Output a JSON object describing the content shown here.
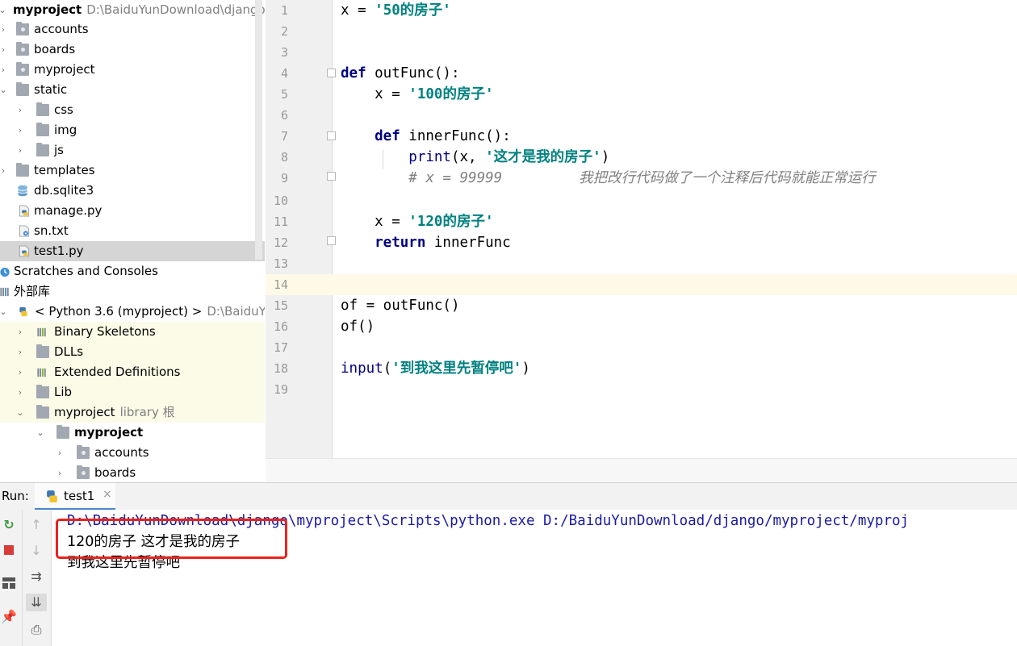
{
  "project_tree": {
    "items": [
      {
        "label": "myproject",
        "hint": "D:\\BaiduYunDownload\\django\\",
        "bold": true
      },
      {
        "label": "accounts"
      },
      {
        "label": "boards"
      },
      {
        "label": "myproject"
      },
      {
        "label": "static"
      },
      {
        "label": "css"
      },
      {
        "label": "img"
      },
      {
        "label": "js"
      },
      {
        "label": "templates"
      },
      {
        "label": "db.sqlite3"
      },
      {
        "label": "manage.py"
      },
      {
        "label": "sn.txt"
      },
      {
        "label": "test1.py",
        "selected": true
      },
      {
        "label": "Scratches and Consoles"
      },
      {
        "label": "外部库"
      },
      {
        "label": "< Python 3.6 (myproject) >",
        "hint": "D:\\BaiduYun"
      },
      {
        "label": "Binary Skeletons"
      },
      {
        "label": "DLLs"
      },
      {
        "label": "Extended Definitions"
      },
      {
        "label": "Lib"
      },
      {
        "label": "myproject",
        "hint": "library 根"
      },
      {
        "label": "myproject",
        "bold": true
      },
      {
        "label": "accounts"
      },
      {
        "label": "boards"
      }
    ]
  },
  "editor": {
    "line_numbers": [
      "1",
      "2",
      "3",
      "4",
      "5",
      "6",
      "7",
      "8",
      "9",
      "10",
      "11",
      "12",
      "13",
      "14",
      "15",
      "16",
      "17",
      "18",
      "19"
    ],
    "current_line": "14",
    "lines": {
      "l1": {
        "a": "x = ",
        "b": "'50的房子'"
      },
      "l4": {
        "kw": "def",
        "fn": " outFunc():"
      },
      "l5": {
        "a": "    x = ",
        "b": "'100的房子'"
      },
      "l7": {
        "kw": "    def",
        "fn": " innerFunc():"
      },
      "l8": {
        "bi": "        print",
        "a": "(x, ",
        "b": "'这才是我的房子'",
        "c": ")"
      },
      "l9": {
        "cm": "        # x = 99999         我把改行代码做了一个注释后代码就能正常运行"
      },
      "l11": {
        "a": "    x = ",
        "b": "'120的房子'"
      },
      "l12": {
        "kw": "    return",
        "a": " innerFunc"
      },
      "l15": {
        "a": "of = outFunc()"
      },
      "l16": {
        "a": "of()"
      },
      "l18": {
        "bi": "input",
        "a": "(",
        "b": "'到我这里先暂停吧'",
        "c": ")"
      }
    }
  },
  "run_panel": {
    "label": "Run:",
    "tab": "test1",
    "tab_close": "×",
    "console": {
      "command": "D:\\BaiduYunDownload\\django\\myproject\\Scripts\\python.exe D:/BaiduYunDownload/django/myproject/myproj",
      "output": [
        "120的房子 这才是我的房子",
        "到我这里先暂停吧"
      ]
    }
  },
  "colors": {
    "highlight_box": "#e8231c",
    "current_line_bg": "#fefae7",
    "keyword": "#000080",
    "string": "#008080"
  },
  "icons": [
    "folder-icon",
    "python-file-icon",
    "database-icon",
    "text-file-icon",
    "scratches-icon",
    "library-icon",
    "python-icon",
    "rerun-icon",
    "stop-icon",
    "layout-icon",
    "pin-icon",
    "up-arrow-icon",
    "down-arrow-icon",
    "soft-wrap-icon",
    "scroll-to-end-icon",
    "print-icon"
  ]
}
